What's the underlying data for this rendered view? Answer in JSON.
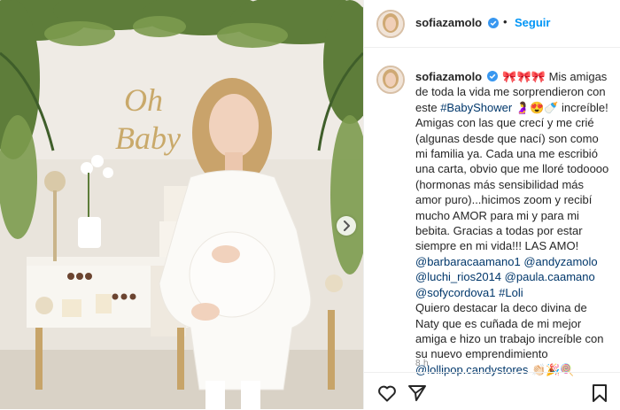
{
  "header": {
    "username": "sofiazamolo",
    "dot": "•",
    "follow_label": "Seguir"
  },
  "photo": {
    "sign_text_1": "Oh",
    "sign_text_2": "Baby"
  },
  "caption": {
    "username": "sofiazamolo",
    "emojis_1": "🎀🎀🎀",
    "text_1": "Mis amigas de toda la vida me sorprendieron con este",
    "hashtag_1": "#BabyShower",
    "emojis_2": "🤰😍🍼",
    "text_2": "increíble! Amigas con las que crecí y me crié (algunas desde que nací) son como mi familia ya. Cada una me escribió una carta, obvio que me lloré todoooo (hormonas más sensibilidad más amor puro)...hicimos zoom y recibí mucho AMOR para mi y para mi bebita. Gracias a todas por estar siempre en mi vida!!! LAS AMO!",
    "mention_1": "@barbaracaamano1",
    "mention_2": "@andyzamolo",
    "mention_3": "@luchi_rios2014",
    "mention_4": "@paula.caamano",
    "mention_5": "@sofycordova1",
    "hashtag_2": "#Loli",
    "text_3": "Quiero destacar la deco divina de Naty que es cuñada de mi mejor amiga e hizo un trabajo increíble con su nuevo emprendimiento",
    "mention_6": "@lollipop.candystores",
    "emojis_3": "👏🏻🎉🍭"
  },
  "timestamp": "8 h",
  "icons": {
    "verified": "verified-badge-icon",
    "like": "heart-icon",
    "share": "paper-plane-icon",
    "save": "bookmark-icon",
    "next": "chevron-right-icon"
  },
  "colors": {
    "accent": "#0095f6",
    "link": "#00376b",
    "text": "#262626",
    "muted": "#8e8e8e"
  }
}
